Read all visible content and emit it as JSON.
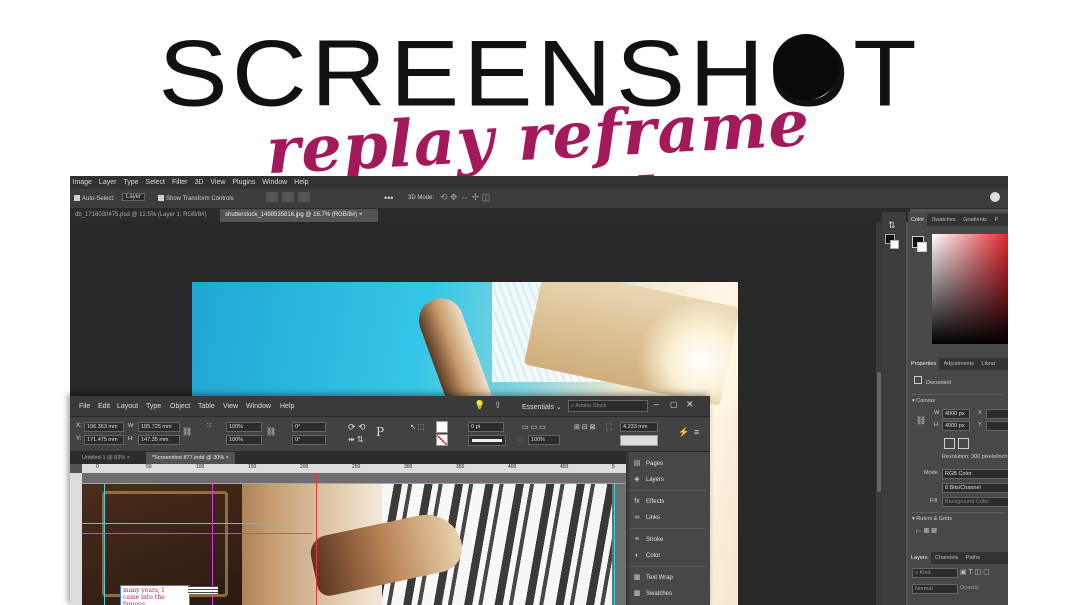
{
  "banner": {
    "title": "SCREENSHOT",
    "tagline": "replay reframe rethink",
    "colors": {
      "title": "#111111",
      "tagline": "#a3195b",
      "dot": "#0a0a0a"
    }
  },
  "photoshop": {
    "menu": [
      "Image",
      "Layer",
      "Type",
      "Select",
      "Filter",
      "3D",
      "View",
      "Plugins",
      "Window",
      "Help"
    ],
    "options": {
      "auto_select": "Auto-Select:",
      "auto_select_target": "Layer",
      "show_transform": "Show Transform Controls",
      "mode_3d": "3D Mode:"
    },
    "tabs": [
      {
        "label": "db_1716030475.psd @ 12.5% (Layer 1, RGB/8#)",
        "active": false
      },
      {
        "label": "shutterstock_1498535816.jpg @ 16.7% (RGB/8#)",
        "active": true
      }
    ],
    "color_panel": {
      "tabs": [
        "Color",
        "Swatches",
        "Gradients",
        "P"
      ]
    },
    "properties_panel": {
      "tabs": [
        "Properties",
        "Adjustments",
        "Librar"
      ],
      "document_label": "Document",
      "canvas_label": "Canvas",
      "w_label": "W",
      "w_value": "4000 px",
      "x_label": "X",
      "h_label": "H",
      "h_value": "4000 px",
      "y_label": "Y",
      "resolution": "Resolution: 300 pixels/inch",
      "mode_label": "Mode",
      "mode_value": "RGB Color",
      "bits_value": "8 Bits/Channel",
      "fill_label": "Fill",
      "fill_value": "Background Color",
      "rulers_label": "Rulers & Grids"
    },
    "layers_panel": {
      "tabs": [
        "Layers",
        "Channels",
        "Paths"
      ],
      "kind_label": "Kind",
      "blend_label": "Normal",
      "opacity_label": "Opacity:"
    }
  },
  "indesign": {
    "menu": [
      "File",
      "Edit",
      "Layout",
      "Type",
      "Object",
      "Table",
      "View",
      "Window",
      "Help"
    ],
    "workspace": "Essentials",
    "search_placeholder": "Adobe Stock",
    "control": {
      "x_value": "106.363 mm",
      "w_label": "W:",
      "w_value": "185.725 mm",
      "y_value": "171.475 mm",
      "h_label": "H:",
      "h_value": "147.35 mm",
      "scale_x": "100%",
      "scale_y": "100%",
      "angle": "0°",
      "shear": "0°",
      "stroke_weight": "0 pt",
      "opacity": "100%",
      "size_value": "4.233 mm"
    },
    "tabs": [
      {
        "label": "Untitled-1 @ 83%",
        "active": false
      },
      {
        "label": "*Screenshot 877.indd @ 30%",
        "active": true
      }
    ],
    "ruler_ticks": [
      "0",
      "50",
      "100",
      "150",
      "200",
      "250",
      "300",
      "350",
      "400",
      "450",
      "5"
    ],
    "text_frame": [
      "many years, I",
      "came into the famous"
    ],
    "panel_items": [
      {
        "icon": "pages-icon",
        "glyph": "▤",
        "label": "Pages"
      },
      {
        "icon": "layers-icon",
        "glyph": "◈",
        "label": "Layers"
      },
      {
        "icon": "effects-icon",
        "glyph": "fx",
        "label": "Effects"
      },
      {
        "icon": "links-icon",
        "glyph": "∞",
        "label": "Links"
      },
      {
        "icon": "stroke-icon",
        "glyph": "≡",
        "label": "Stroke"
      },
      {
        "icon": "color-icon",
        "glyph": "◐",
        "label": "Color"
      },
      {
        "icon": "text-wrap-icon",
        "glyph": "▦",
        "label": "Text Wrap"
      },
      {
        "icon": "swatches-icon",
        "glyph": "▩",
        "label": "Swatches"
      }
    ]
  }
}
